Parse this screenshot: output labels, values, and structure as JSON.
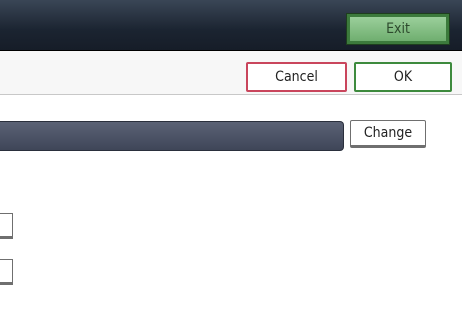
{
  "header": {
    "exit_label": "Exit"
  },
  "dialog": {
    "cancel_label": "Cancel",
    "ok_label": "OK"
  },
  "field": {
    "change_label": "Change"
  }
}
